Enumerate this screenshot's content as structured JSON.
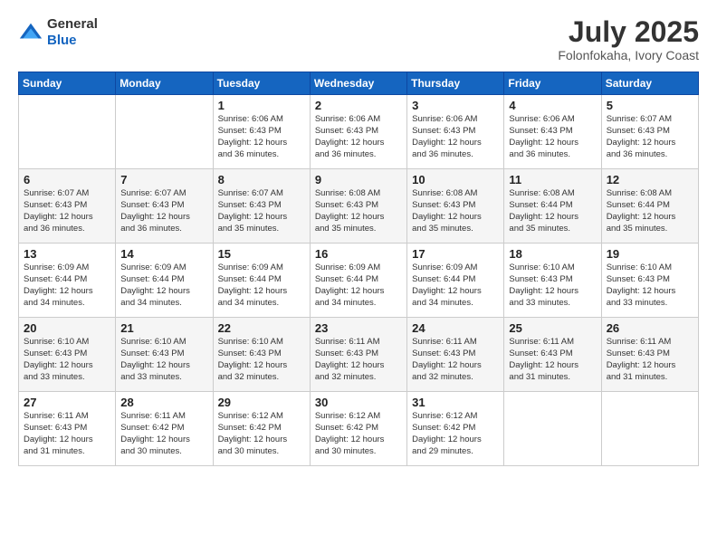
{
  "header": {
    "logo_line1": "General",
    "logo_line2": "Blue",
    "month_year": "July 2025",
    "location": "Folonfokaha, Ivory Coast"
  },
  "weekdays": [
    "Sunday",
    "Monday",
    "Tuesday",
    "Wednesday",
    "Thursday",
    "Friday",
    "Saturday"
  ],
  "weeks": [
    [
      {
        "day": "",
        "info": ""
      },
      {
        "day": "",
        "info": ""
      },
      {
        "day": "1",
        "info": "Sunrise: 6:06 AM\nSunset: 6:43 PM\nDaylight: 12 hours\nand 36 minutes."
      },
      {
        "day": "2",
        "info": "Sunrise: 6:06 AM\nSunset: 6:43 PM\nDaylight: 12 hours\nand 36 minutes."
      },
      {
        "day": "3",
        "info": "Sunrise: 6:06 AM\nSunset: 6:43 PM\nDaylight: 12 hours\nand 36 minutes."
      },
      {
        "day": "4",
        "info": "Sunrise: 6:06 AM\nSunset: 6:43 PM\nDaylight: 12 hours\nand 36 minutes."
      },
      {
        "day": "5",
        "info": "Sunrise: 6:07 AM\nSunset: 6:43 PM\nDaylight: 12 hours\nand 36 minutes."
      }
    ],
    [
      {
        "day": "6",
        "info": "Sunrise: 6:07 AM\nSunset: 6:43 PM\nDaylight: 12 hours\nand 36 minutes."
      },
      {
        "day": "7",
        "info": "Sunrise: 6:07 AM\nSunset: 6:43 PM\nDaylight: 12 hours\nand 36 minutes."
      },
      {
        "day": "8",
        "info": "Sunrise: 6:07 AM\nSunset: 6:43 PM\nDaylight: 12 hours\nand 35 minutes."
      },
      {
        "day": "9",
        "info": "Sunrise: 6:08 AM\nSunset: 6:43 PM\nDaylight: 12 hours\nand 35 minutes."
      },
      {
        "day": "10",
        "info": "Sunrise: 6:08 AM\nSunset: 6:43 PM\nDaylight: 12 hours\nand 35 minutes."
      },
      {
        "day": "11",
        "info": "Sunrise: 6:08 AM\nSunset: 6:44 PM\nDaylight: 12 hours\nand 35 minutes."
      },
      {
        "day": "12",
        "info": "Sunrise: 6:08 AM\nSunset: 6:44 PM\nDaylight: 12 hours\nand 35 minutes."
      }
    ],
    [
      {
        "day": "13",
        "info": "Sunrise: 6:09 AM\nSunset: 6:44 PM\nDaylight: 12 hours\nand 34 minutes."
      },
      {
        "day": "14",
        "info": "Sunrise: 6:09 AM\nSunset: 6:44 PM\nDaylight: 12 hours\nand 34 minutes."
      },
      {
        "day": "15",
        "info": "Sunrise: 6:09 AM\nSunset: 6:44 PM\nDaylight: 12 hours\nand 34 minutes."
      },
      {
        "day": "16",
        "info": "Sunrise: 6:09 AM\nSunset: 6:44 PM\nDaylight: 12 hours\nand 34 minutes."
      },
      {
        "day": "17",
        "info": "Sunrise: 6:09 AM\nSunset: 6:44 PM\nDaylight: 12 hours\nand 34 minutes."
      },
      {
        "day": "18",
        "info": "Sunrise: 6:10 AM\nSunset: 6:43 PM\nDaylight: 12 hours\nand 33 minutes."
      },
      {
        "day": "19",
        "info": "Sunrise: 6:10 AM\nSunset: 6:43 PM\nDaylight: 12 hours\nand 33 minutes."
      }
    ],
    [
      {
        "day": "20",
        "info": "Sunrise: 6:10 AM\nSunset: 6:43 PM\nDaylight: 12 hours\nand 33 minutes."
      },
      {
        "day": "21",
        "info": "Sunrise: 6:10 AM\nSunset: 6:43 PM\nDaylight: 12 hours\nand 33 minutes."
      },
      {
        "day": "22",
        "info": "Sunrise: 6:10 AM\nSunset: 6:43 PM\nDaylight: 12 hours\nand 32 minutes."
      },
      {
        "day": "23",
        "info": "Sunrise: 6:11 AM\nSunset: 6:43 PM\nDaylight: 12 hours\nand 32 minutes."
      },
      {
        "day": "24",
        "info": "Sunrise: 6:11 AM\nSunset: 6:43 PM\nDaylight: 12 hours\nand 32 minutes."
      },
      {
        "day": "25",
        "info": "Sunrise: 6:11 AM\nSunset: 6:43 PM\nDaylight: 12 hours\nand 31 minutes."
      },
      {
        "day": "26",
        "info": "Sunrise: 6:11 AM\nSunset: 6:43 PM\nDaylight: 12 hours\nand 31 minutes."
      }
    ],
    [
      {
        "day": "27",
        "info": "Sunrise: 6:11 AM\nSunset: 6:43 PM\nDaylight: 12 hours\nand 31 minutes."
      },
      {
        "day": "28",
        "info": "Sunrise: 6:11 AM\nSunset: 6:42 PM\nDaylight: 12 hours\nand 30 minutes."
      },
      {
        "day": "29",
        "info": "Sunrise: 6:12 AM\nSunset: 6:42 PM\nDaylight: 12 hours\nand 30 minutes."
      },
      {
        "day": "30",
        "info": "Sunrise: 6:12 AM\nSunset: 6:42 PM\nDaylight: 12 hours\nand 30 minutes."
      },
      {
        "day": "31",
        "info": "Sunrise: 6:12 AM\nSunset: 6:42 PM\nDaylight: 12 hours\nand 29 minutes."
      },
      {
        "day": "",
        "info": ""
      },
      {
        "day": "",
        "info": ""
      }
    ]
  ]
}
